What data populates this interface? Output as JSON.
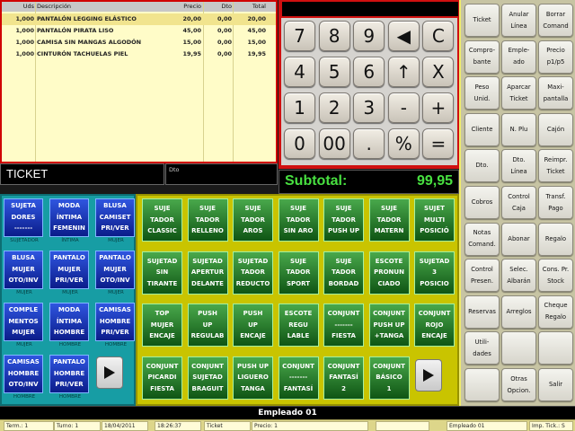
{
  "ticket": {
    "columns": {
      "uds": "Uds",
      "desc": "Descripción",
      "precio": "Precio",
      "dto": "Dto",
      "total": "Total"
    },
    "rows": [
      {
        "uds": "1,000",
        "desc": "PANTALÓN LEGGING ELÁSTICO",
        "precio": "20,00",
        "dto": "0,00",
        "total": "20,00"
      },
      {
        "uds": "1,000",
        "desc": "PANTALÓN PIRATA LISO",
        "precio": "45,00",
        "dto": "0,00",
        "total": "45,00"
      },
      {
        "uds": "1,000",
        "desc": "CAMISA SIN MANGAS ALGODÓN",
        "precio": "15,00",
        "dto": "0,00",
        "total": "15,00"
      },
      {
        "uds": "1,000",
        "desc": "CINTURÓN TACHUELAS PIEL",
        "precio": "19,95",
        "dto": "0,00",
        "total": "19,95"
      }
    ],
    "label": "TICKET",
    "dto_label": "Dto"
  },
  "keypad": {
    "keys": [
      "7",
      "8",
      "9",
      "◀",
      "C",
      "4",
      "5",
      "6",
      "↑",
      "X",
      "1",
      "2",
      "3",
      "-",
      "+",
      "0",
      "00",
      ".",
      "%",
      "="
    ]
  },
  "subtotal": {
    "label": "Subtotal:",
    "value": "99,95"
  },
  "functions": [
    "Ticket",
    "Anular\nLínea",
    "Borrar\nComand",
    "Compro-\nbante",
    "Emple-\nado",
    "Precio\np1/p5",
    "Peso\nUnid.",
    "Aparcar\nTicket",
    "Maxi-\npantalla",
    "Cliente",
    "N. Plu",
    "Cajón",
    "Dto.",
    "Dto.\nLínea",
    "Reimpr.\nTicket",
    "Cobros",
    "Control\nCaja",
    "Transf.\nPago",
    "Notas\nComand.",
    "Abonar",
    "Regalo",
    "Control\nPresen.",
    "Selec.\nAlbarán",
    "Cons. Pr.\nStock",
    "Reservas",
    "Arreglos",
    "Cheque\nRegalo",
    "Utili-\ndades",
    "",
    "",
    "",
    "Otras\nOpcion.",
    "Salir"
  ],
  "families": [
    {
      "label": "SUJETA\nDORES\n-------",
      "caption": "SUJETADOR"
    },
    {
      "label": "MODA\nÍNTIMA\nFEMENIN",
      "caption": "ÍNTIMA"
    },
    {
      "label": "BLUSA\nCAMISET\nPRI/VER",
      "caption": "MUJER"
    },
    {
      "label": "BLUSA\nMUJER\nOTO/INV",
      "caption": "MUJER"
    },
    {
      "label": "PANTALO\nMUJER\nPRI/VER",
      "caption": "MUJER"
    },
    {
      "label": "PANTALO\nMUJER\nOTO/INV",
      "caption": "MUJER"
    },
    {
      "label": "COMPLE\nMENTOS\nMUJER",
      "caption": "MUJER"
    },
    {
      "label": "MODA\nÍNTIMA\nHOMBRE",
      "caption": "HOMBRE"
    },
    {
      "label": "CAMISAS\nHOMBRE\nPRI/VER",
      "caption": "HOMBRE"
    },
    {
      "label": "CAMISAS\nHOMBRE\nOTO/INV",
      "caption": "HOMBRE"
    },
    {
      "label": "PANTALO\nHOMBRE\nPRI/VER",
      "caption": "HOMBRE"
    }
  ],
  "products": [
    "SUJE\nTADOR\nCLASSIC",
    "SUJE\nTADOR\nRELLENO",
    "SUJE\nTADOR\nAROS",
    "SUJE\nTADOR\nSIN ARO",
    "SUJE\nTADOR\nPUSH UP",
    "SUJE\nTADOR\nMATERN",
    "SUJET\nMULTI\nPOSICIÓ",
    "SUJETAD\nSIN\nTIRANTE",
    "SUJETAD\nAPERTUR\nDELANTE",
    "SUJETAD\nTADOR\nREDUCTO",
    "SUJE\nTADOR\nSPORT",
    "SUJE\nTADOR\nBORDAD",
    "ESCOTE\nPRONUN\nCIADO",
    "SUJETAD\n3\nPOSICIO",
    "TOP\nMUJER\nENCAJE",
    "PUSH\nUP\nREGULAB",
    "PUSH\nUP\nENCAJE",
    "ESCOTE\nREGU\nLABLE",
    "CONJUNT\n-------\nFIESTA",
    "CONJUNT\nPUSH UP\n+TANGA",
    "CONJUNT\nROJO\nENCAJE",
    "CONJUNT\nPICARDI\nFIESTA",
    "CONJUNT\nSUJETAD\nBRAGUIT",
    "PUSH UP\nLIGUERO\nTANGA",
    "CONJUNT\n-------\nFANTASÍ",
    "CONJUNT\nFANTASÍ\n2",
    "CONJUNT\nBÁSICO\n1"
  ],
  "employee_bar": "Empleado 01",
  "status": {
    "term": "Term.: 1",
    "turno": "Turno: 1",
    "date": "18/04/2011",
    "time": "18:26:37",
    "doc": "Ticket",
    "precio": "Precio: 1",
    "empleado": "Empleado 01",
    "imp": "Imp. Tick.: S"
  },
  "colors": {
    "ticket_border": "#d00000",
    "subtotal_text": "#48e040",
    "family_button": "#1a3bc4",
    "product_button": "#2a7d2c",
    "product_panel": "#c9c400"
  },
  "icons": {
    "nav_next": "play-right-icon"
  }
}
